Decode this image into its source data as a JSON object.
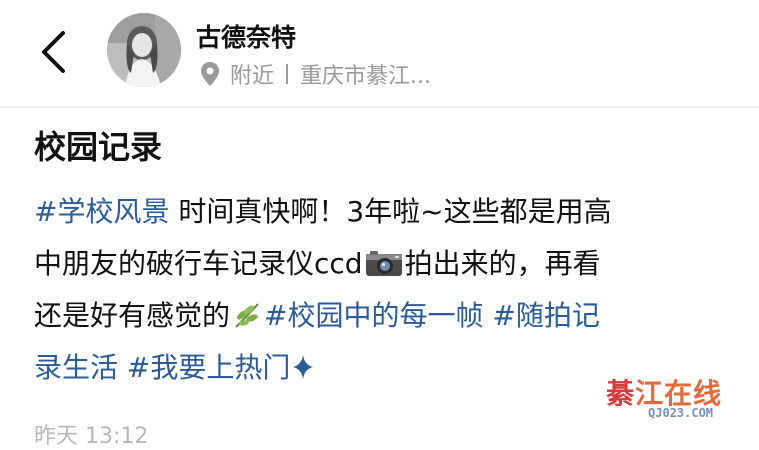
{
  "header": {
    "user_name": "古德奈特",
    "location_label": "附近",
    "location_value": "重庆市綦江..."
  },
  "post": {
    "title": "校园记录",
    "lines": [
      {
        "tag": "#学校风景",
        "text": " 时间真快啊！3年啦~这些都是用高"
      },
      {
        "text_before": "中朋友的破行车记录仪ccd",
        "text_after": "拍出来的，再看"
      },
      {
        "text": "还是好有感觉的",
        "tag1": "#校园中的每一帧",
        "tag2": "#随拍记"
      },
      {
        "tag": "录生活 #我要上热门"
      }
    ],
    "emojis": [
      "camera-emoji",
      "herb-emoji",
      "sparkle-emoji"
    ],
    "timestamp": "昨天 13:12"
  },
  "watermark": {
    "main_char1": "綦",
    "main_rest": "江在线",
    "url": "QJ023.COM"
  },
  "colors": {
    "tag": "#2a5c97",
    "secondary_text": "#9a9a9a",
    "watermark_red": "#d93a3a"
  }
}
